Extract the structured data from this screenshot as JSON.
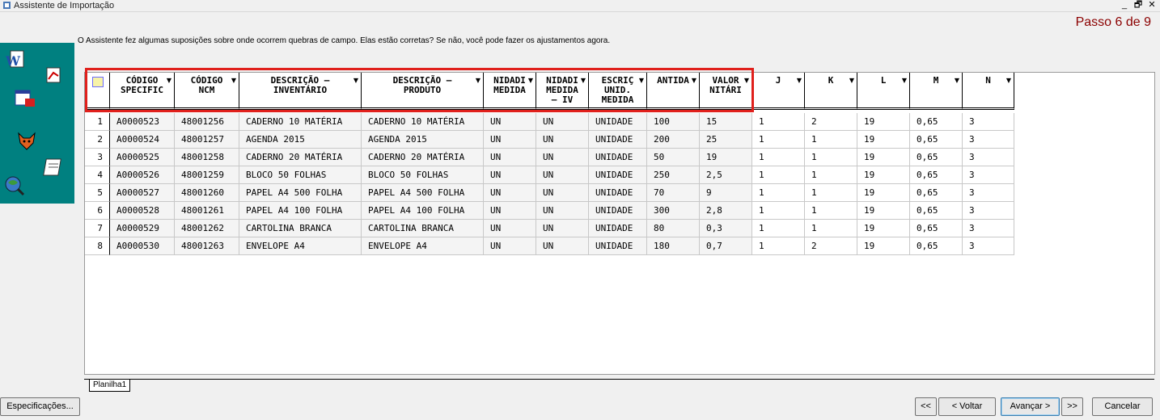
{
  "window": {
    "title": "Assistente de Importação",
    "minimize_glyph": "_",
    "restore_glyph": "🗗",
    "close_glyph": "✕"
  },
  "step_label": "Passo 6 de 9",
  "instructions": "O Assistente fez algumas suposições sobre onde ocorrem quebras de campo. Elas estão corretas? Se não, você pode fazer os ajustamentos agora.",
  "icons": [
    "word-document-icon",
    "spreadsheet-chart-icon",
    "form-icon",
    "fox-icon",
    "notebook-icon",
    "web-search-icon"
  ],
  "grid": {
    "columns": [
      {
        "label": "CÓDIGO\nSPECIFIC"
      },
      {
        "label": "CÓDIGO\nNCM"
      },
      {
        "label": "DESCRIÇÃO –\nINVENTÁRIO"
      },
      {
        "label": "DESCRIÇÃO –\nPRODUTO"
      },
      {
        "label": "NIDADI\nMEDIDA"
      },
      {
        "label": "NIDADI\nMEDIDA\n– IV"
      },
      {
        "label": "ESCRIÇ\nUNID.\nMEDIDA"
      },
      {
        "label": "ANTIDA"
      },
      {
        "label": "VALOR\nNITÁRI"
      },
      {
        "label": "J"
      },
      {
        "label": "K"
      },
      {
        "label": "L"
      },
      {
        "label": "M"
      },
      {
        "label": "N"
      }
    ],
    "rows": [
      {
        "num": "1",
        "cells": [
          "A0000523",
          "48001256",
          "CADERNO 10 MATÉRIA",
          "CADERNO 10 MATÉRIA",
          "UN",
          "UN",
          "UNIDADE",
          "100",
          "15",
          "1",
          "2",
          "19",
          "0,65",
          "3"
        ]
      },
      {
        "num": "2",
        "cells": [
          "A0000524",
          "48001257",
          "AGENDA 2015",
          "AGENDA 2015",
          "UN",
          "UN",
          "UNIDADE",
          "200",
          "25",
          "1",
          "1",
          "19",
          "0,65",
          "3"
        ]
      },
      {
        "num": "3",
        "cells": [
          "A0000525",
          "48001258",
          "CADERNO 20 MATÉRIA",
          "CADERNO 20 MATÉRIA",
          "UN",
          "UN",
          "UNIDADE",
          "50",
          "19",
          "1",
          "1",
          "19",
          "0,65",
          "3"
        ]
      },
      {
        "num": "4",
        "cells": [
          "A0000526",
          "48001259",
          "BLOCO 50 FOLHAS",
          "BLOCO 50 FOLHAS",
          "UN",
          "UN",
          "UNIDADE",
          "250",
          "2,5",
          "1",
          "1",
          "19",
          "0,65",
          "3"
        ]
      },
      {
        "num": "5",
        "cells": [
          "A0000527",
          "48001260",
          "PAPEL A4 500 FOLHA",
          "PAPEL A4 500 FOLHA",
          "UN",
          "UN",
          "UNIDADE",
          "70",
          "9",
          "1",
          "1",
          "19",
          "0,65",
          "3"
        ]
      },
      {
        "num": "6",
        "cells": [
          "A0000528",
          "48001261",
          "PAPEL A4 100 FOLHA",
          "PAPEL A4 100 FOLHA",
          "UN",
          "UN",
          "UNIDADE",
          "300",
          "2,8",
          "1",
          "1",
          "19",
          "0,65",
          "3"
        ]
      },
      {
        "num": "7",
        "cells": [
          "A0000529",
          "48001262",
          "CARTOLINA BRANCA",
          "CARTOLINA BRANCA",
          "UN",
          "UN",
          "UNIDADE",
          "80",
          "0,3",
          "1",
          "1",
          "19",
          "0,65",
          "3"
        ]
      },
      {
        "num": "8",
        "cells": [
          "A0000530",
          "48001263",
          "ENVELOPE A4",
          "ENVELOPE A4",
          "UN",
          "UN",
          "UNIDADE",
          "180",
          "0,7",
          "1",
          "2",
          "19",
          "0,65",
          "3"
        ]
      }
    ]
  },
  "sheet_tab": "Planilha1",
  "buttons": {
    "specs": "Especificações...",
    "first": "<<",
    "back": "< Voltar",
    "next": "Avançar >",
    "last": ">>",
    "cancel": "Cancelar"
  },
  "colors": {
    "step": "#8b0000",
    "icon_panel": "#008080",
    "highlight_box": "#e0201c"
  }
}
